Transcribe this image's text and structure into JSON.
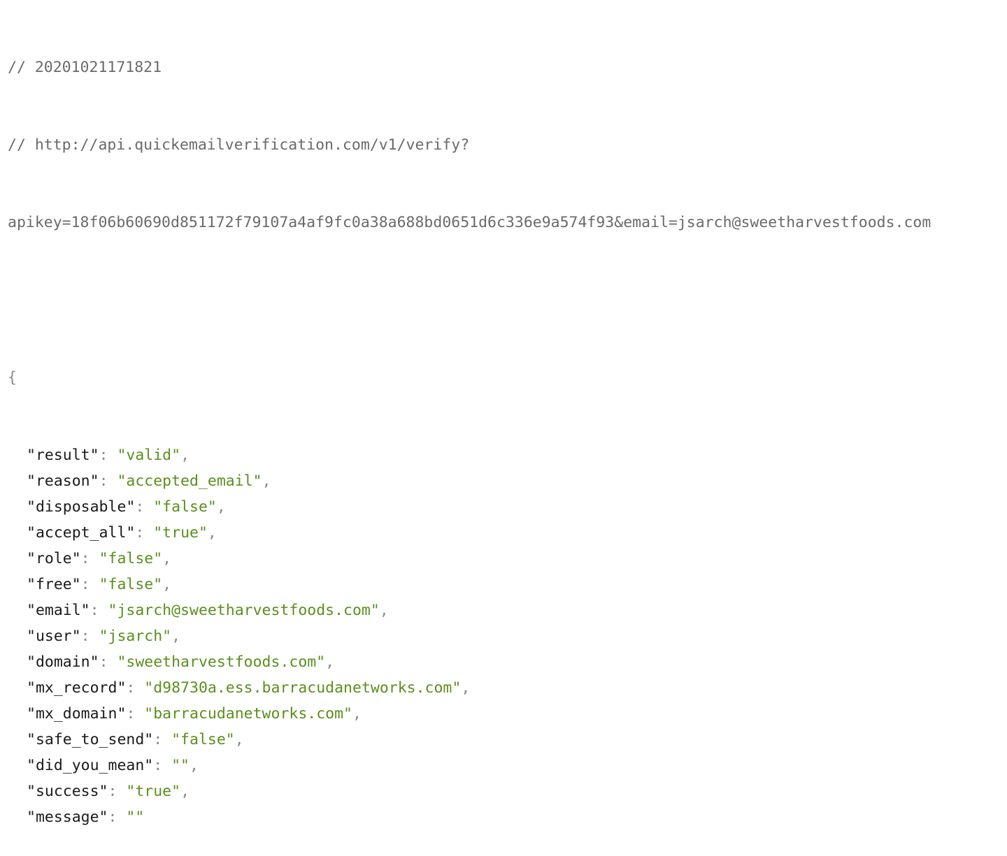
{
  "comments": {
    "timestamp": "// 20201021171821",
    "url_line1": "// http://api.quickemailverification.com/v1/verify?",
    "url_line2": "apikey=18f06b60690d851172f79107a4af9fc0a38a688bd0651d6c336e9a574f93&email=jsarch@sweetharvestfoods.com"
  },
  "json": {
    "open_brace": "{",
    "entries": [
      {
        "key": "\"result\"",
        "value": "\"valid\"",
        "trail": ","
      },
      {
        "key": "\"reason\"",
        "value": "\"accepted_email\"",
        "trail": ","
      },
      {
        "key": "\"disposable\"",
        "value": "\"false\"",
        "trail": ","
      },
      {
        "key": "\"accept_all\"",
        "value": "\"true\"",
        "trail": ","
      },
      {
        "key": "\"role\"",
        "value": "\"false\"",
        "trail": ","
      },
      {
        "key": "\"free\"",
        "value": "\"false\"",
        "trail": ","
      },
      {
        "key": "\"email\"",
        "value": "\"jsarch@sweetharvestfoods.com\"",
        "trail": ","
      },
      {
        "key": "\"user\"",
        "value": "\"jsarch\"",
        "trail": ","
      },
      {
        "key": "\"domain\"",
        "value": "\"sweetharvestfoods.com\"",
        "trail": ","
      },
      {
        "key": "\"mx_record\"",
        "value": "\"d98730a.ess.barracudanetworks.com\"",
        "trail": ","
      },
      {
        "key": "\"mx_domain\"",
        "value": "\"barracudanetworks.com\"",
        "trail": ","
      },
      {
        "key": "\"safe_to_send\"",
        "value": "\"false\"",
        "trail": ","
      },
      {
        "key": "\"did_you_mean\"",
        "value": "\"\"",
        "trail": ","
      },
      {
        "key": "\"success\"",
        "value": "\"true\"",
        "trail": ","
      },
      {
        "key": "\"message\"",
        "value": "\"\"",
        "trail": ""
      }
    ]
  },
  "colors": {
    "string_value": "#5a8f1c",
    "comment": "#6a6a6a",
    "punctuation": "#8a8a8a",
    "key": "#1a1a1a"
  }
}
